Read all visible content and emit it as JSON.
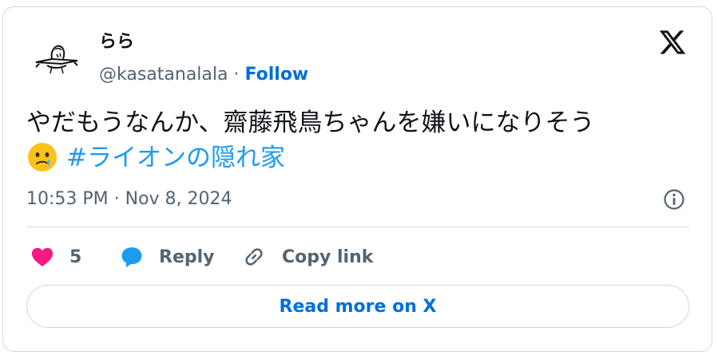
{
  "author": {
    "display_name": "らら",
    "handle": "@kasatanalala",
    "separator": " · ",
    "follow_label": "Follow"
  },
  "brand_icon": "x-logo-icon",
  "tweet": {
    "text": "やだもうなんか、齋藤飛鳥ちゃんを嫌いになりそう",
    "emoji": "face-holding-back-tears-icon",
    "hashtag": "#ライオンの隠れ家",
    "timestamp": "10:53 PM · Nov 8, 2024"
  },
  "actions": {
    "like_count": "5",
    "reply_label": "Reply",
    "copy_label": "Copy link"
  },
  "read_more_label": "Read more on X",
  "colors": {
    "accent": "#006fd6",
    "hashtag": "#1d9bf0",
    "like": "#f91880",
    "reply_icon": "#1d9bf0",
    "secondary_text": "#536471",
    "border": "#cfd9de"
  }
}
